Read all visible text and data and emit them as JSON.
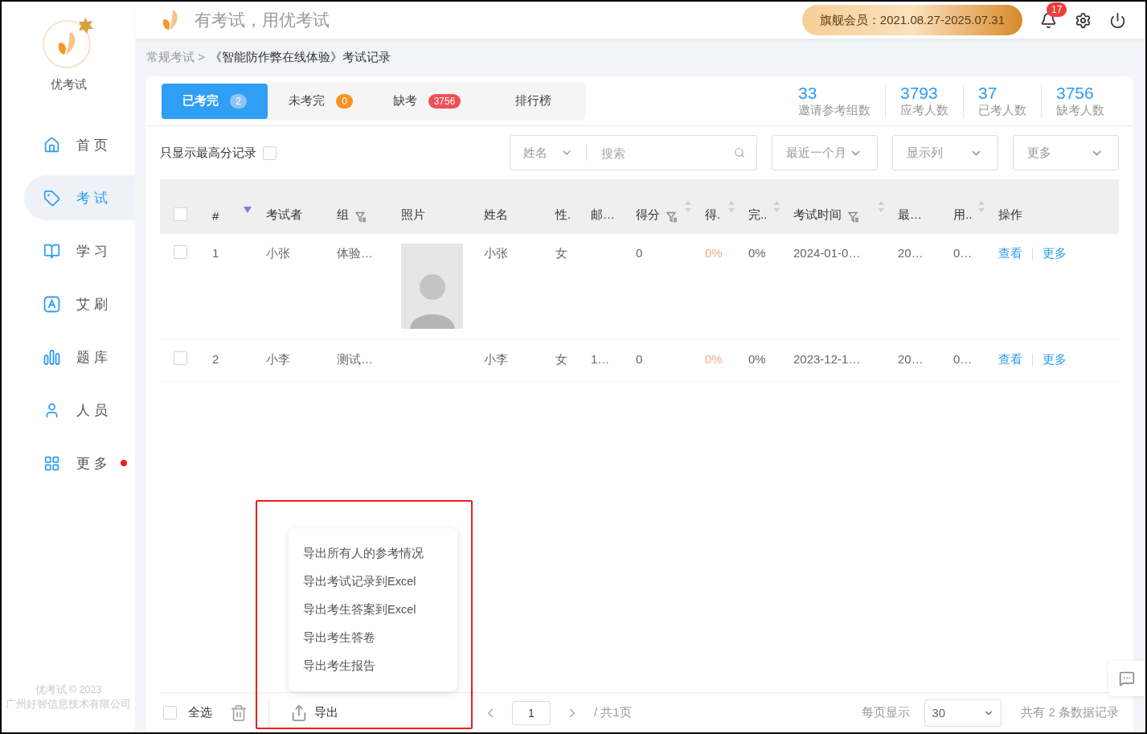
{
  "sidebar": {
    "app_name": "优考试",
    "items": [
      {
        "label": "首 页",
        "selected": false,
        "dot": false
      },
      {
        "label": "考 试",
        "selected": true,
        "dot": false
      },
      {
        "label": "学 习",
        "selected": false,
        "dot": false
      },
      {
        "label": "艾 刷",
        "selected": false,
        "dot": false
      },
      {
        "label": "题 库",
        "selected": false,
        "dot": false
      },
      {
        "label": "人 员",
        "selected": false,
        "dot": false
      },
      {
        "label": "更 多",
        "selected": false,
        "dot": true
      }
    ],
    "footer": [
      "优考试 © 2023",
      "广州好智信息技术有限公司"
    ]
  },
  "header": {
    "slogan": "有考试，用优考试",
    "membership": "旗舰会员：2021.08.27-2025.07.31",
    "notifications": "17"
  },
  "breadcrumb": [
    "常规考试 >",
    "《智能防作弊在线体验》考试记录"
  ],
  "tabs": [
    {
      "label": "已考完",
      "badge": "2",
      "color": "#8ec4f8",
      "selected": true
    },
    {
      "label": "未考完",
      "badge": "0",
      "color": "#f7931e",
      "selected": false
    },
    {
      "label": "缺考",
      "badge": "3756",
      "color": "#f04e55",
      "selected": false
    },
    {
      "label": "排行榜",
      "selected": false
    }
  ],
  "stats": [
    {
      "value": "33",
      "label": "邀请参考组数"
    },
    {
      "value": "3793",
      "label": "应考人数"
    },
    {
      "value": "37",
      "label": "已考人数"
    },
    {
      "value": "3756",
      "label": "缺考人数"
    }
  ],
  "filters": {
    "highest_only": {
      "label": "只显示最高分记录",
      "checked": false
    },
    "search": {
      "field": "姓名",
      "placeholder": "搜索"
    },
    "dropdowns": [
      "最近一个月",
      "显示列",
      "更多"
    ]
  },
  "table": {
    "all_selected": false,
    "columns": [
      {
        "label": "#",
        "kind": "text",
        "sortable": true,
        "sorted": true,
        "filter": false
      },
      {
        "label": "考试者",
        "kind": "text",
        "sortable": false,
        "filter": false
      },
      {
        "label": "组",
        "kind": "text",
        "sortable": false,
        "filter": true
      },
      {
        "label": "照片",
        "kind": "photo",
        "sortable": false,
        "filter": false
      },
      {
        "label": "姓名",
        "kind": "text",
        "sortable": false,
        "filter": false
      },
      {
        "label": "性.",
        "kind": "text",
        "sortable": false,
        "filter": false
      },
      {
        "label": "邮…",
        "kind": "text",
        "sortable": false,
        "filter": false
      },
      {
        "label": "得分",
        "kind": "text",
        "sortable": true,
        "sorted": false,
        "filter": true
      },
      {
        "label": "得.",
        "kind": "text",
        "sortable": true,
        "sorted": false,
        "filter": false,
        "color": "#f6a98c"
      },
      {
        "label": "完..",
        "kind": "text",
        "sortable": true,
        "sorted": false,
        "filter": false
      },
      {
        "label": "考试时间",
        "kind": "text",
        "sortable": true,
        "sorted": false,
        "filter": true
      },
      {
        "label": "最…",
        "kind": "text",
        "sortable": false,
        "filter": false
      },
      {
        "label": "用..",
        "kind": "text",
        "sortable": true,
        "sorted": false,
        "filter": false
      },
      {
        "label": "操作",
        "kind": "actions",
        "sortable": false,
        "filter": false
      }
    ],
    "rows": [
      {
        "selected": false,
        "photo": true,
        "cells": [
          "1",
          "小张",
          "体验…",
          null,
          "小张",
          "女",
          null,
          "0",
          "0%",
          "0%",
          "2024-01-0…",
          "20…",
          "0…"
        ],
        "actions": [
          "查看",
          "更多"
        ]
      },
      {
        "selected": false,
        "photo": false,
        "cells": [
          "2",
          "小李",
          "测试…",
          null,
          "小李",
          "女",
          "1…",
          "0",
          "0%",
          "0%",
          "2023-12-1…",
          "20…",
          "0…"
        ],
        "actions": [
          "查看",
          "更多"
        ]
      }
    ]
  },
  "footer_bar": {
    "select_all": {
      "label": "全选",
      "checked": false
    },
    "export": "导出",
    "page": "1",
    "total_pages": "/ 共1页",
    "per_page_label": "每页显示",
    "per_page": "30",
    "total": "共有 2 条数据记录"
  },
  "export_menu": {
    "items": [
      "导出所有人的参考情况",
      "导出考试记录到Excel",
      "导出考生答案到Excel",
      "导出考生答卷",
      "导出考生报告"
    ]
  }
}
